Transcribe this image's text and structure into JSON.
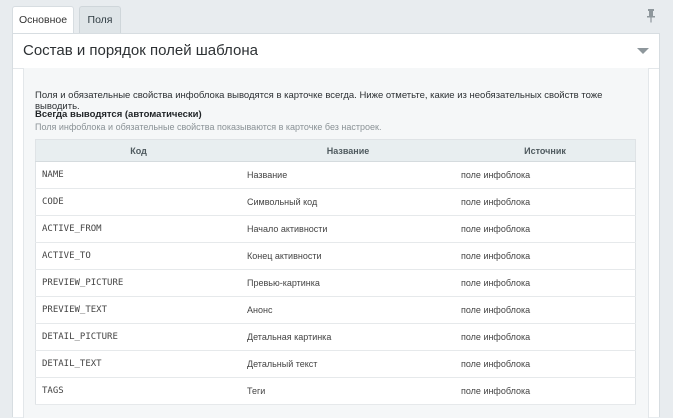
{
  "tabs": [
    {
      "label": "Основное"
    },
    {
      "label": "Поля"
    }
  ],
  "icons": {
    "pin": "pin-icon",
    "collapse": "collapse-arrow-icon"
  },
  "panel": {
    "title": "Состав и порядок полей шаблона",
    "intro": "Поля и обязательные свойства инфоблока выводятся в карточке всегда. Ниже отметьте, какие из необязательных свойств тоже выводить.",
    "section_title": "Всегда выводятся (автоматически)",
    "section_note": "Поля инфоблока и обязательные свойства показываются в карточке без настроек."
  },
  "table": {
    "columns": [
      "Код",
      "Название",
      "Источник"
    ],
    "rows": [
      {
        "code": "NAME",
        "name": "Название",
        "source": "поле инфоблока"
      },
      {
        "code": "CODE",
        "name": "Символьный код",
        "source": "поле инфоблока"
      },
      {
        "code": "ACTIVE_FROM",
        "name": "Начало активности",
        "source": "поле инфоблока"
      },
      {
        "code": "ACTIVE_TO",
        "name": "Конец активности",
        "source": "поле инфоблока"
      },
      {
        "code": "PREVIEW_PICTURE",
        "name": "Превью-картинка",
        "source": "поле инфоблока"
      },
      {
        "code": "PREVIEW_TEXT",
        "name": "Анонс",
        "source": "поле инфоблока"
      },
      {
        "code": "DETAIL_PICTURE",
        "name": "Детальная картинка",
        "source": "поле инфоблока"
      },
      {
        "code": "DETAIL_TEXT",
        "name": "Детальный текст",
        "source": "поле инфоблока"
      },
      {
        "code": "TAGS",
        "name": "Теги",
        "source": "поле инфоблока"
      }
    ]
  }
}
